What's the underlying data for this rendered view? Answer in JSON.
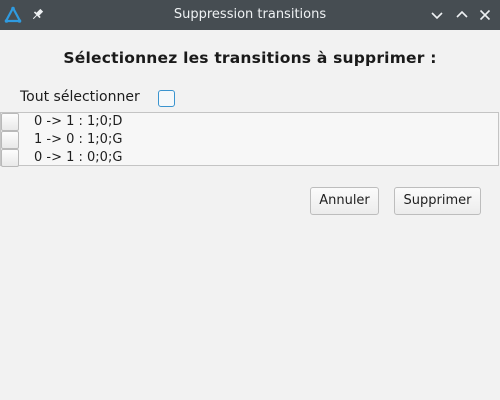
{
  "window": {
    "title": "Suppression transitions",
    "icons": {
      "app": "app-triangle-icon",
      "pin": "pin-icon",
      "minimize": "chevron-down-icon",
      "maximize": "chevron-up-icon",
      "close": "close-icon"
    }
  },
  "dialog": {
    "heading": "Sélectionnez les transitions à supprimer :",
    "select_all_label": "Tout sélectionner",
    "select_all_checked": false,
    "transitions": [
      {
        "label": "0 -> 1 : 1;0;D",
        "checked": false
      },
      {
        "label": "1 -> 0 : 1;0;G",
        "checked": false
      },
      {
        "label": "0 -> 1 : 0;0;G",
        "checked": false
      }
    ],
    "buttons": {
      "cancel": "Annuler",
      "delete": "Supprimer"
    }
  },
  "colors": {
    "titlebar": "#464d52",
    "accent": "#3a94cf",
    "background": "#f2f2f2"
  }
}
